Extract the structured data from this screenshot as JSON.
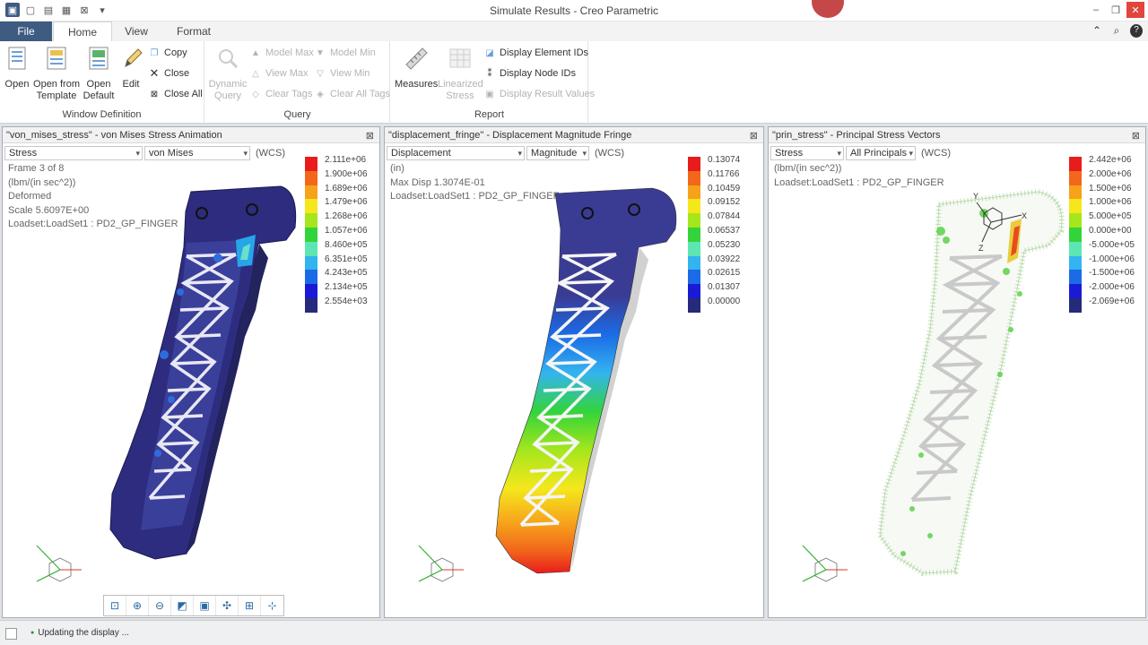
{
  "window": {
    "title": "Simulate Results - Creo Parametric"
  },
  "tabs": [
    "File",
    "Home",
    "View",
    "Format"
  ],
  "ribbon": {
    "window_definition": {
      "label": "Window Definition",
      "open": "Open",
      "open_template_1": "Open from",
      "open_template_2": "Template",
      "open_default_1": "Open",
      "open_default_2": "Default",
      "edit": "Edit",
      "copy": "Copy",
      "close": "Close",
      "close_all": "Close All"
    },
    "query": {
      "label": "Query",
      "dynamic_1": "Dynamic",
      "dynamic_2": "Query",
      "model_max": "Model Max",
      "model_min": "Model Min",
      "view_max": "View Max",
      "view_min": "View Min",
      "clear_tags": "Clear Tags",
      "clear_all_tags": "Clear All Tags"
    },
    "report": {
      "label": "Report",
      "measures": "Measures",
      "linearized_1": "Linearized",
      "linearized_2": "Stress",
      "display_element_ids": "Display Element IDs",
      "display_node_ids": "Display Node IDs",
      "display_result_values": "Display Result Values"
    }
  },
  "panels": [
    {
      "title": "\"von_mises_stress\" - von Mises Stress Animation",
      "select1": "Stress",
      "select2": "von Mises",
      "wcs": "(WCS)",
      "info": [
        "Frame 3 of 8",
        "(lbm/(in sec^2))",
        "Deformed",
        "Scale  5.6097E+00",
        "Loadset:LoadSet1 :  PD2_GP_FINGER"
      ],
      "legend": [
        "2.111e+06",
        "1.900e+06",
        "1.689e+06",
        "1.479e+06",
        "1.268e+06",
        "1.057e+06",
        "8.460e+05",
        "6.351e+05",
        "4.243e+05",
        "2.134e+05",
        "2.554e+03"
      ]
    },
    {
      "title": "\"displacement_fringe\" - Displacement Magnitude Fringe",
      "select1": "Displacement",
      "select2": "Magnitude",
      "wcs": "(WCS)",
      "info": [
        "(in)",
        "Max Disp  1.3074E-01",
        "Loadset:LoadSet1 :  PD2_GP_FINGER"
      ],
      "legend": [
        "0.13074",
        "0.11766",
        "0.10459",
        "0.09152",
        "0.07844",
        "0.06537",
        "0.05230",
        "0.03922",
        "0.02615",
        "0.01307",
        "0.00000"
      ]
    },
    {
      "title": "\"prin_stress\" - Principal Stress Vectors",
      "select1": "Stress",
      "select2": "All Principals",
      "wcs": "(WCS)",
      "info": [
        "(lbm/(in sec^2))",
        "Loadset:LoadSet1 :  PD2_GP_FINGER"
      ],
      "legend": [
        "2.442e+06",
        "2.000e+06",
        "1.500e+06",
        "1.000e+06",
        "5.000e+05",
        "0.000e+00",
        "-5.000e+05",
        "-1.000e+06",
        "-1.500e+06",
        "-2.000e+06",
        "-2.069e+06"
      ]
    }
  ],
  "legend_colors": [
    "#e81c1c",
    "#f2671b",
    "#f6a21b",
    "#f5e71c",
    "#a5e61d",
    "#32d43a",
    "#5de6b3",
    "#33b4f0",
    "#1b6be6",
    "#1a1ad6",
    "#262a7a"
  ],
  "view_tools": [
    "zoom-fit-icon",
    "zoom-in-icon",
    "zoom-out-icon",
    "repaint-icon",
    "saved-views-icon",
    "spin-center-icon",
    "display-style-icon",
    "annotation-icon"
  ],
  "status": {
    "text": "Updating the display ..."
  }
}
